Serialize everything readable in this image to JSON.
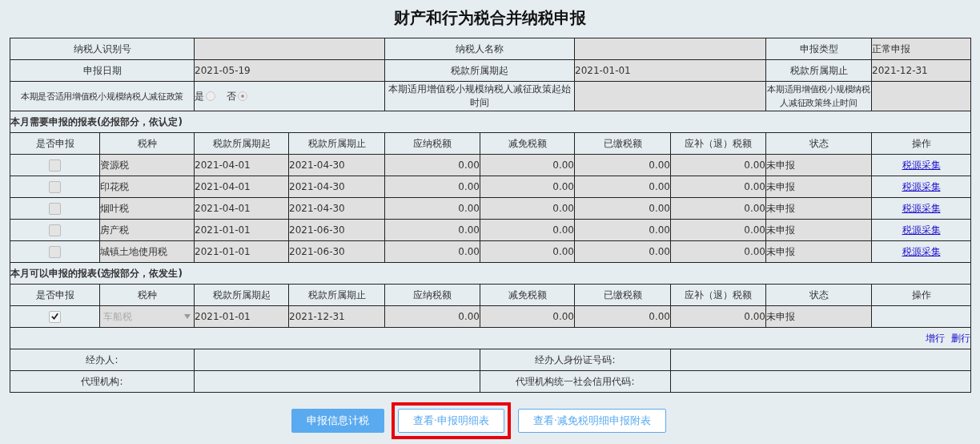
{
  "title": "财产和行为税合并纳税申报",
  "info_rows": [
    [
      {
        "label": "纳税人识别号"
      },
      {
        "label": "纳税人名称"
      },
      {
        "label": "申报类型",
        "value": "正常申报"
      }
    ],
    [
      {
        "label": "申报日期",
        "value": "2021-05-19"
      },
      {
        "label": "税款所属期起",
        "value": "2021-01-01"
      },
      {
        "label": "税款所属期止",
        "value": "2021-12-31"
      }
    ]
  ],
  "policy": {
    "label": "本期是否适用增值税小规模纳税人减征政策",
    "options": [
      {
        "label": "是",
        "selected": false
      },
      {
        "label": "否",
        "selected": true
      }
    ],
    "start_label": "本期适用增值税小规模纳税人减征政策起始时间",
    "end_label": "本期适用增值税小规模纳税人减征政策终止时间"
  },
  "sections": [
    {
      "title": "本月需要申报的报表(必报部分，依认定)",
      "columns": [
        "是否申报",
        "税种",
        "税款所属期起",
        "税款所属期止",
        "应纳税额",
        "减免税额",
        "已缴税额",
        "应补（退）税额",
        "状态",
        "操作"
      ],
      "rows": [
        {
          "kind": "fixed",
          "checked": false,
          "tax": "资源税",
          "start": "2021-04-01",
          "end": "2021-04-30",
          "payable": "0.00",
          "reduced": "0.00",
          "paid": "0.00",
          "due": "0.00",
          "status": "未申报",
          "action": "税源采集"
        },
        {
          "kind": "fixed",
          "checked": false,
          "tax": "印花税",
          "start": "2021-04-01",
          "end": "2021-04-30",
          "payable": "0.00",
          "reduced": "0.00",
          "paid": "0.00",
          "due": "0.00",
          "status": "未申报",
          "action": "税源采集"
        },
        {
          "kind": "fixed",
          "checked": false,
          "tax": "烟叶税",
          "start": "2021-04-01",
          "end": "2021-04-30",
          "payable": "0.00",
          "reduced": "0.00",
          "paid": "0.00",
          "due": "0.00",
          "status": "未申报",
          "action": "税源采集"
        },
        {
          "kind": "fixed",
          "checked": false,
          "tax": "房产税",
          "start": "2021-01-01",
          "end": "2021-06-30",
          "payable": "0.00",
          "reduced": "0.00",
          "paid": "0.00",
          "due": "0.00",
          "status": "未申报",
          "action": "税源采集"
        },
        {
          "kind": "fixed",
          "checked": false,
          "tax": "城镇土地使用税",
          "start": "2021-01-01",
          "end": "2021-06-30",
          "payable": "0.00",
          "reduced": "0.00",
          "paid": "0.00",
          "due": "0.00",
          "status": "未申报",
          "action": "税源采集"
        }
      ]
    },
    {
      "title": "本月可以申报的报表(选报部分，依发生)",
      "columns": [
        "是否申报",
        "税种",
        "税款所属期起",
        "税款所属期止",
        "应纳税额",
        "减免税额",
        "已缴税额",
        "应补（退）税额",
        "状态",
        "操作"
      ],
      "rows": [
        {
          "kind": "select",
          "checked": true,
          "tax": "车船税",
          "start": "2021-01-01",
          "end": "2021-12-31",
          "payable": "0.00",
          "reduced": "0.00",
          "paid": "0.00",
          "due": "0.00",
          "status": "未申报"
        }
      ],
      "row_actions": [
        "增行",
        "删行"
      ]
    }
  ],
  "footer_rows": [
    [
      {
        "label": "经办人:"
      },
      {
        "label": "经办人身份证号码:"
      }
    ],
    [
      {
        "label": "代理机构:"
      },
      {
        "label": "代理机构统一社会信用代码:"
      }
    ]
  ],
  "buttons": [
    {
      "label": "申报信息计税",
      "kind": "primary",
      "highlighted": false
    },
    {
      "label": "查看·申报明细表",
      "kind": "outline",
      "highlighted": true
    },
    {
      "label": "查看·减免税明细申报附表",
      "kind": "outline",
      "highlighted": false
    }
  ]
}
